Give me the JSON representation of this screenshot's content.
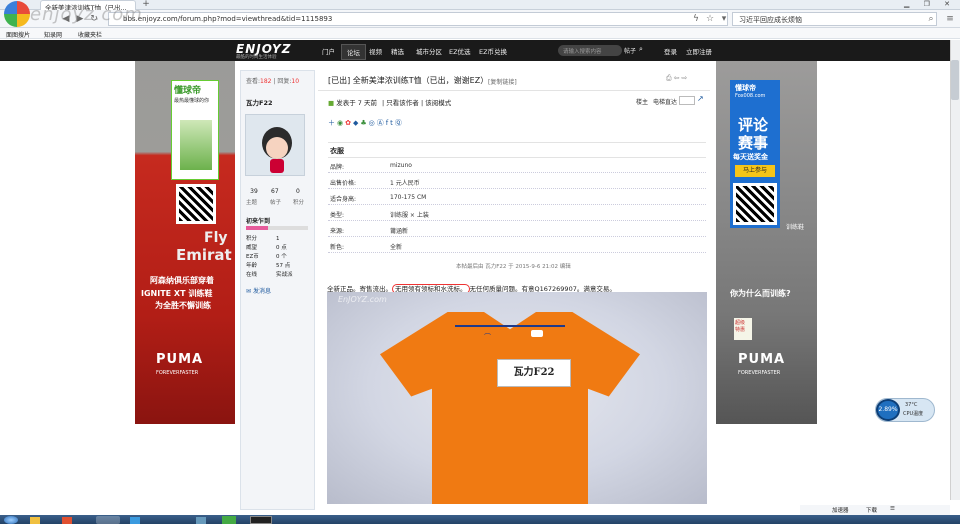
{
  "browser": {
    "tab_title": "全新美津浓训练T恤（已出...",
    "new_tab": "+",
    "window_controls": "▁ ❐ ✕",
    "watermark": "enjoyz.com",
    "url": "bbs.enjoyz.com/forum.php?mod=viewthread&tid=1115893",
    "search_text": "习近平回应成长烦恼",
    "favorites": [
      "面图搜片",
      "知录网",
      "收藏夹栏"
    ],
    "status_items": [
      "加速器",
      "下载",
      "☰"
    ]
  },
  "site": {
    "logo": "ENJOYZ",
    "logo_sub": "最酷的时尚生活体验",
    "nav": [
      "门户",
      "论坛",
      "视频",
      "精选",
      "城市分区",
      "EZ优选",
      "EZ币兑换"
    ],
    "active_nav": "论坛",
    "search_placeholder": "请输入搜索内容",
    "search_btn": "帖子",
    "login": "登录",
    "register": "立即注册"
  },
  "ad_left": {
    "brand": "懂球帝",
    "tagline": "最热最懂球的你",
    "text1": "Fly",
    "text2": "Emirat",
    "headline": "阿森纳俱乐部穿着",
    "product": "IGNITE XT 训练鞋",
    "slogan": "为全胜不懈训练",
    "puma": "PUMA",
    "forever": "FOREVERFASTER"
  },
  "ad_right": {
    "brand": "懂球帝",
    "site": "Fox008.com",
    "big1": "评论",
    "big2": "赛事",
    "sub": "每天送奖金",
    "btn": "马上参与",
    "product": "训练鞋",
    "question": "你为什么而训练?",
    "mini": "超级\n特惠",
    "puma": "PUMA",
    "forever": "FOREVERFASTER"
  },
  "stats": {
    "views_label": "查看",
    "views": "182",
    "replies_label": "回复",
    "replies": "10"
  },
  "thread_title": "[已出] 全新美津浓训练T恤（已出，谢谢EZ）",
  "copy_link": "[复制链接]",
  "author": {
    "name": "瓦力F22",
    "topics": "39",
    "topics_label": "主题",
    "posts": "67",
    "posts_label": "帖子",
    "credits": "0",
    "credits_label": "积分",
    "level": "初来乍到",
    "fields": [
      [
        "积分",
        "1"
      ],
      [
        "威望",
        "0 点"
      ],
      [
        "EZ币",
        "0 个"
      ],
      [
        "年龄",
        "57 点"
      ],
      [
        "在线",
        "实战派"
      ]
    ],
    "send_msg": "发消息"
  },
  "post_meta": {
    "published": "发表于 7 天前",
    "view_author": "只看该作者",
    "read_mode": "该阅模式",
    "floor": "楼主",
    "jump": "电梯直达"
  },
  "share_icons": [
    "＋",
    "◉",
    "✿",
    "◆",
    "♣",
    "◎",
    "Ⓐ",
    "f",
    "t",
    "Ⓠ"
  ],
  "category": "衣服",
  "details": [
    [
      "品牌:",
      "mizuno"
    ],
    [
      "出售价格:",
      "1 元人民币"
    ],
    [
      "适合身高:",
      "170-175 CM"
    ],
    [
      "类型:",
      "训练服 × 上装"
    ],
    [
      "来源:",
      "莆涵新"
    ],
    [
      "新色:",
      "全新"
    ]
  ],
  "edit_note": "本帖最后由 瓦力F22 于 2015-9-6 21:02 编辑",
  "body_text_a": "全新正品。寄售流出。",
  "body_text_b": "无用领有领标和水洗标。",
  "body_text_c": "无任何质量问题。有意Q167269907。满意交易。",
  "photo_watermark": "EnJOYZ.com",
  "photo_tag": "瓦力F22",
  "temp_widget": {
    "value": "2.89%",
    "cpu": "37°C",
    "cpu_label": "CPU温度"
  },
  "colors": {
    "nav_bg": "#1a1a1a",
    "accent_blue": "#1f5a9e",
    "shirt": "#f07a12",
    "sale_red": "#c62a1f"
  }
}
